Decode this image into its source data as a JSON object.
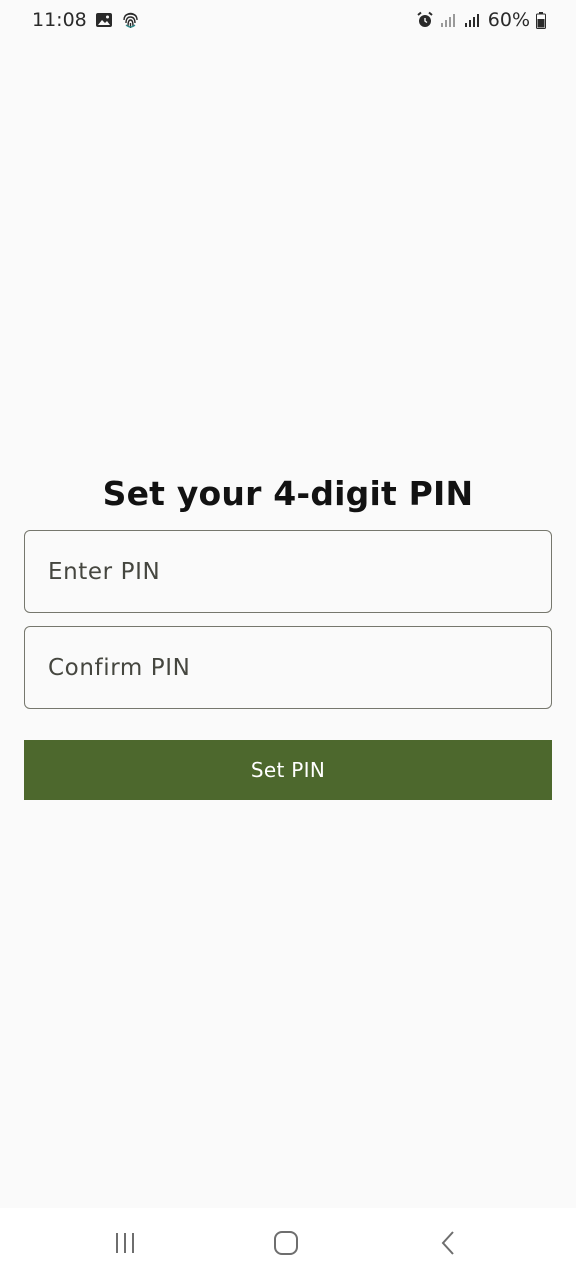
{
  "status_bar": {
    "time": "11:08",
    "battery_percent": "60%",
    "left_icons": [
      "gallery-icon",
      "fingerprint-icon"
    ],
    "right_icons": [
      "alarm-icon",
      "signal-icon",
      "signal-icon"
    ]
  },
  "main": {
    "title": "Set your 4-digit PIN",
    "enter_pin": {
      "value": "",
      "placeholder": "Enter PIN"
    },
    "confirm_pin": {
      "value": "",
      "placeholder": "Confirm PIN"
    },
    "submit_label": "Set PIN"
  },
  "nav_bar": {
    "icons": [
      "recents-icon",
      "home-icon",
      "back-icon"
    ]
  },
  "colors": {
    "background": "#fafafa",
    "button": "#4d682d",
    "button_text": "#ffffff",
    "field_border": "#76776d",
    "title": "#121212"
  }
}
